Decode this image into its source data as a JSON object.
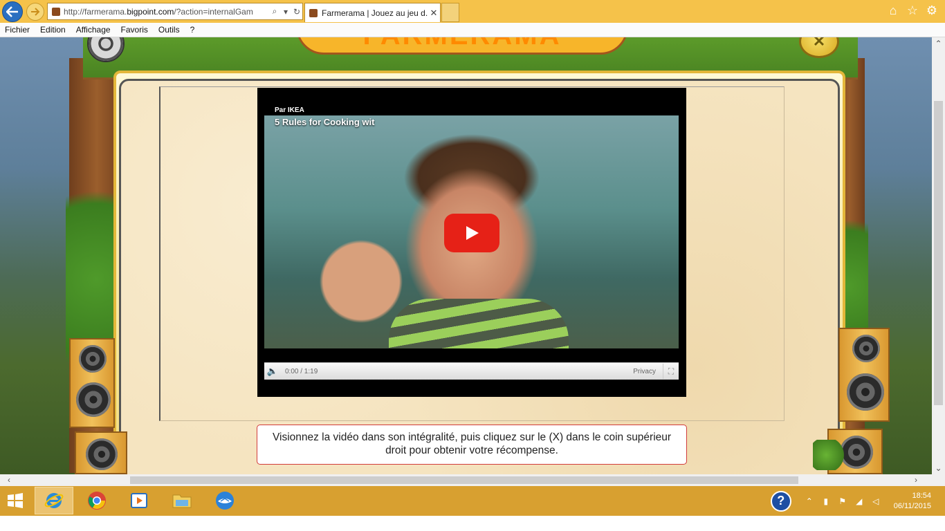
{
  "browser": {
    "url_prefix": "http://farmerama.",
    "url_domain": "bigpoint.com",
    "url_suffix": "/?action=internalGam",
    "tab_title": "Farmerama | Jouez au jeu d...",
    "tab_close": "✕",
    "menu": [
      "Fichier",
      "Edition",
      "Affichage",
      "Favoris",
      "Outils",
      "?"
    ],
    "icons": [
      "back-arrow-icon",
      "forward-arrow-icon",
      "search-icon",
      "refresh-icon",
      "home-icon",
      "star-icon",
      "gear-icon"
    ]
  },
  "game": {
    "logo_text": "FARMERAMA",
    "close_label": "✕"
  },
  "video": {
    "channel": "Par IKEA",
    "title": "5 Rules for Cooking wit",
    "time": "0:00 / 1:19",
    "privacy": "Privacy",
    "progress": 0,
    "play_color": "#e62117"
  },
  "instruction": {
    "line1": "Visionnez la vidéo dans son intégralité, puis cliquez sur le (X) dans le coin supérieur",
    "line2": "droit pour obtenir votre récompense."
  },
  "taskbar": {
    "apps": [
      "windows-start-icon",
      "internet-explorer-icon",
      "chrome-icon",
      "media-player-icon",
      "file-explorer-icon",
      "thunderbird-icon"
    ],
    "time": "18:54",
    "date": "06/11/2015",
    "accent": "#d8a030"
  }
}
